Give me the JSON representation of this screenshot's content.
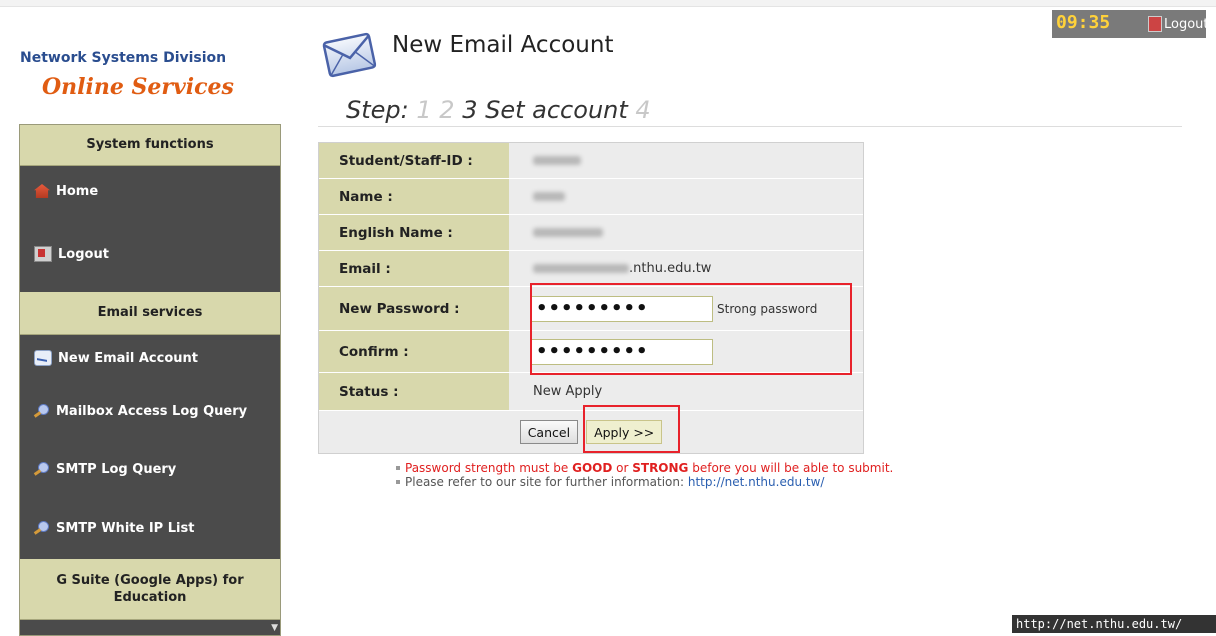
{
  "brand": {
    "org": "Network Systems Division",
    "service": "Online Services"
  },
  "sidebar": {
    "sections": [
      {
        "heading": "System functions"
      },
      {
        "heading": "Email services"
      },
      {
        "heading": "G Suite (Google Apps) for Education"
      }
    ],
    "items": [
      {
        "label": "Home",
        "icon": "home-icon"
      },
      {
        "label": "Logout",
        "icon": "logout-icon"
      },
      {
        "label": "New Email Account",
        "icon": "mail-icon"
      },
      {
        "label": "Mailbox Access Log Query",
        "icon": "search-icon"
      },
      {
        "label": "SMTP Log Query",
        "icon": "search-icon"
      },
      {
        "label": "SMTP White IP List",
        "icon": "search-icon"
      }
    ]
  },
  "header": {
    "title": "New Email Account",
    "step_prefix": "Step:",
    "step_1": "1",
    "step_2": "2",
    "step_3": "3 Set account",
    "step_4": "4",
    "clock": "09:35",
    "logout": "Logout"
  },
  "form": {
    "student_id_label": "Student/Staff-ID :",
    "name_label": "Name :",
    "english_name_label": "English Name :",
    "email_label": "Email :",
    "email_visible_suffix": ".nthu.edu.tw",
    "new_password_label": "New Password :",
    "new_password_value": "•••••••••",
    "strength": "Strong password",
    "confirm_label": "Confirm :",
    "confirm_value": "•••••••••",
    "status_label": "Status :",
    "status_value": "New Apply",
    "cancel": "Cancel",
    "apply": "Apply >>"
  },
  "notes": {
    "n1_pre": "Password strength must be ",
    "n1_good": "GOOD",
    "n1_or": " or ",
    "n1_strong": "STRONG",
    "n1_post": " before you will be able to submit.",
    "n2_pre": "Please refer to our site for further information: ",
    "n2_link": "http://net.nthu.edu.tw/"
  },
  "statusbar": "http://net.nthu.edu.tw/",
  "colors": {
    "highlight": "#e8222b",
    "label_bg": "#d8d8ac",
    "sidebar_bg": "#4b4b4b",
    "brand_orange": "#e05c12",
    "brand_blue": "#2a4d8f"
  }
}
